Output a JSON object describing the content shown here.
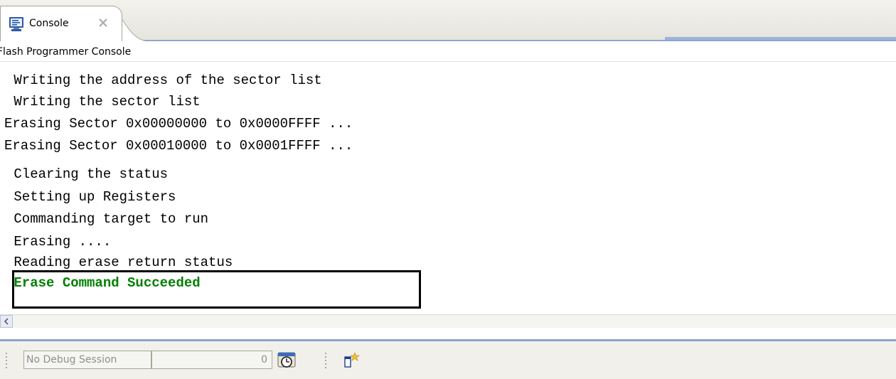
{
  "tab": {
    "icon": "console-icon",
    "label": "Console",
    "close_icon": "close-icon"
  },
  "console": {
    "title": "Flash Programmer Console",
    "lines": [
      " Writing the address of the sector list",
      " Writing the sector list",
      "Erasing Sector 0x00000000 to 0x0000FFFF ...",
      "Erasing Sector 0x00010000 to 0x0001FFFF ...",
      " Clearing the status",
      " Setting up Registers",
      " Commanding target to run",
      " Erasing ....",
      " Reading erase return status",
      " Erase Command Succeeded"
    ],
    "success_color": "#008000"
  },
  "statusbar": {
    "session": "No Debug Session",
    "count": "0",
    "timer_icon": "timer-icon",
    "new_view_icon": "new-view-icon"
  },
  "colors": {
    "accent": "#8ba5cd",
    "chrome": "#f1f0ea"
  }
}
